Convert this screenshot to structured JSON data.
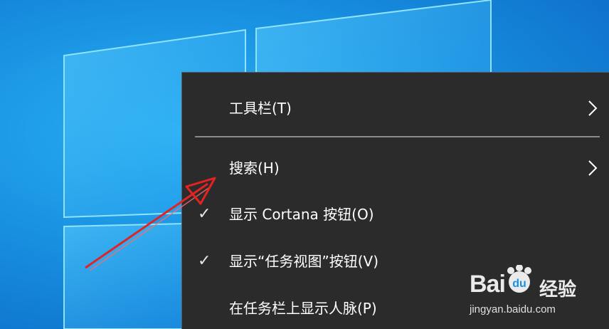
{
  "context_menu": {
    "items": [
      {
        "label": "工具栏(T)",
        "has_submenu": true,
        "checked": false
      },
      {
        "label": "搜索(H)",
        "has_submenu": true,
        "checked": false
      },
      {
        "label": "显示 Cortana 按钮(O)",
        "has_submenu": false,
        "checked": true
      },
      {
        "label": "显示“任务视图”按钮(V)",
        "has_submenu": false,
        "checked": true
      },
      {
        "label": "在任务栏上显示人脉(P)",
        "has_submenu": false,
        "checked": false
      }
    ],
    "check_glyph": "✓"
  },
  "watermark": {
    "brand": "Bai",
    "brand_suffix": "经验",
    "url": "jingyan.baidu.com"
  },
  "colors": {
    "menu_bg": "#2b2b2b",
    "menu_text": "#ffffff",
    "annotation_arrow": "#e52222"
  }
}
